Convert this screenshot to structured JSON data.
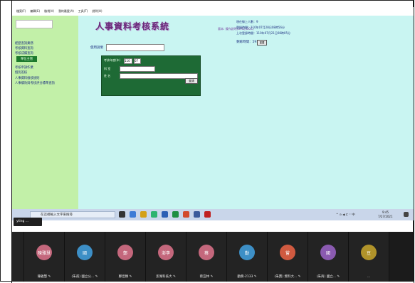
{
  "menubar": [
    "檔案(F)",
    "編輯(E)",
    "檢視(V)",
    "我的最愛(A)",
    "工具(T)",
    "說明(H)"
  ],
  "sidebar": {
    "items": [
      {
        "label": "經歷查詢業務"
      },
      {
        "label": "考核資料查詢"
      },
      {
        "label": "考核成績查詢"
      },
      {
        "label": "單位主管",
        "selected": true
      },
      {
        "label": "考核申訴作業"
      },
      {
        "label": "個別差核"
      },
      {
        "label": "人事資料檢核規則"
      },
      {
        "label": "人事績效與考核評分標準查詢"
      }
    ]
  },
  "header": {
    "logo_text": "人事資料考核系統",
    "system_name": "版本: 操作說明(OML)(DOC)",
    "online_users": "現在線上人數：9",
    "login_time": "登錄時間：110年07月28日08時56分",
    "last_login": "上次登錄時間：110年07月21日08時05分",
    "remaining_label": "剩餘時間：",
    "remaining_value": "59:56",
    "refresh_label": "重置"
  },
  "search": {
    "label": "使用說明",
    "placeholder": ""
  },
  "panel": {
    "row1_label": "考核年度(年)",
    "row1_value": "110",
    "row1_value2": "07",
    "row2_label": "科 室",
    "row3_label": "姓 名",
    "query_button": "查詢"
  },
  "taskbar": {
    "search_placeholder": "在這裡輸入文字來搜尋",
    "time": "9:45",
    "date": "7/27/2021",
    "tray": "^ ⊙ ◀ ⊏ ⁽ ⁾ 中"
  },
  "ytag_label": "yting ...",
  "colors": {
    "screen_bg": "#c9f5f2",
    "sidebar_bg": "#c2f0a8",
    "panel_bg": "#1e6a35",
    "meeting_bg": "#1b1b1b"
  },
  "meeting": {
    "participants": [
      {
        "initials": "蓮萍",
        "name": "...",
        "color": "#c4677c"
      },
      {
        "initials": "陳雅慧",
        "name": "陳雅慧 ✎",
        "color": "#c4677c"
      },
      {
        "initials": "國",
        "name": "(朱甫) 國立公... ✎",
        "color": "#3d8fc6"
      },
      {
        "initials": "鄭",
        "name": "鄭佳臻 ✎",
        "color": "#c4677c"
      },
      {
        "initials": "澎李",
        "name": "澎湖科技大 ✎",
        "color": "#c4677c"
      },
      {
        "initials": "蔡",
        "name": "蔡宜林 ✎",
        "color": "#c4677c"
      },
      {
        "initials": "勤",
        "name": "勤務-2133 ✎",
        "color": "#3d8fc6"
      },
      {
        "initials": "嘗",
        "name": "(朱賈) 資料大... ✎",
        "color": "#d05a40"
      },
      {
        "initials": "國",
        "name": "(朱商) 國立... ✎",
        "color": "#8a5ab0"
      },
      {
        "initials": "豆",
        "name": "...",
        "color": "#b0932a"
      }
    ]
  }
}
